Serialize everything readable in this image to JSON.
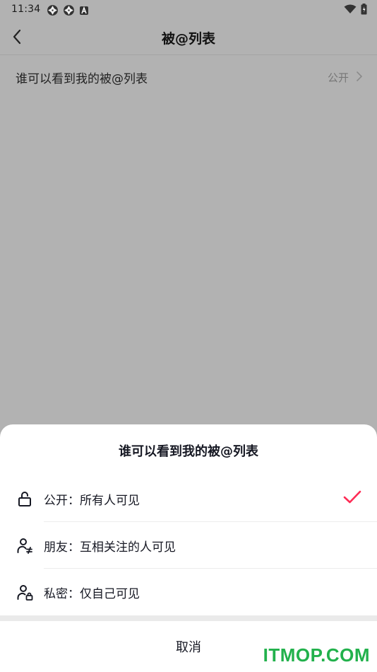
{
  "status_bar": {
    "time": "11:34"
  },
  "nav": {
    "title": "被@列表"
  },
  "setting": {
    "label": "谁可以看到我的被@列表",
    "value": "公开"
  },
  "sheet": {
    "title": "谁可以看到我的被@列表",
    "options": [
      {
        "label": "公开：所有人可见",
        "icon": "unlock-icon",
        "selected": true
      },
      {
        "label": "朋友：互相关注的人可见",
        "icon": "friends-icon",
        "selected": false
      },
      {
        "label": "私密：仅自己可见",
        "icon": "private-user-icon",
        "selected": false
      }
    ],
    "cancel_label": "取消"
  },
  "colors": {
    "accent": "#fe2c55",
    "overlay": "#b2b2b2",
    "watermark": "#22b14c"
  },
  "watermark": "ITMOP.COM"
}
